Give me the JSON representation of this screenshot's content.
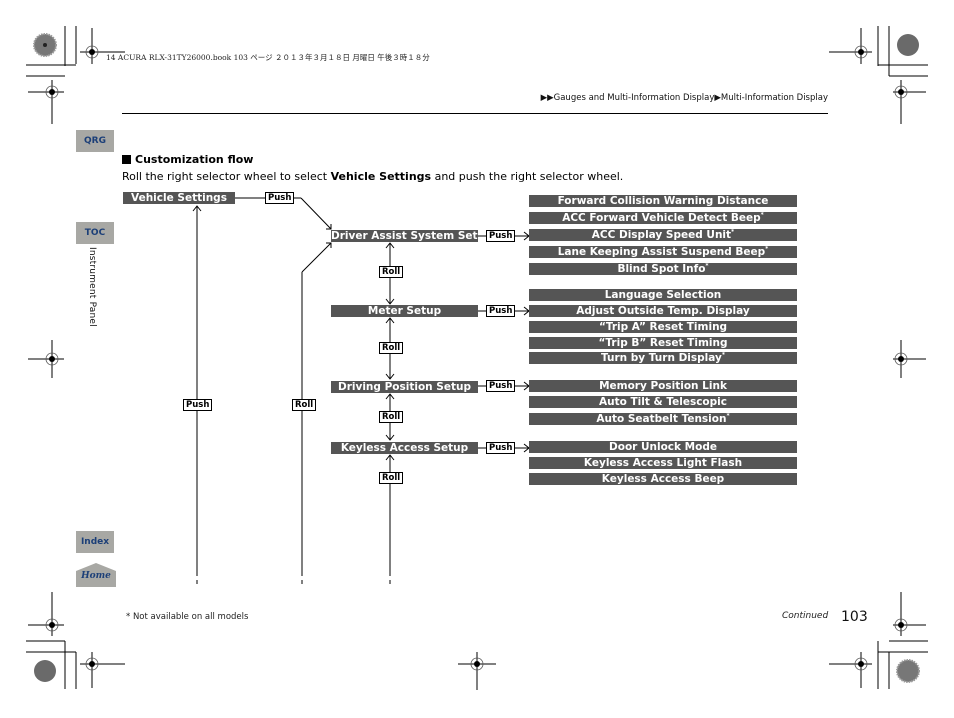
{
  "print_header": "14 ACURA RLX-31TY26000.book  103 ページ  ２０１３年３月１８日  月曜日  午後３時１８分",
  "breadcrumb": {
    "arrow": "▶▶",
    "parts": [
      "Gauges and Multi-Information Display",
      "Multi-Information Display"
    ],
    "separator": "▶"
  },
  "side_nav": {
    "qrg": "QRG",
    "toc": "TOC",
    "section_label": "Instrument Panel",
    "index": "Index",
    "home": "Home"
  },
  "section": {
    "title": "Customization flow",
    "instruction_pre": "Roll the right selector wheel to select ",
    "instruction_bold": "Vehicle Settings",
    "instruction_post": " and push the right selector wheel."
  },
  "flow": {
    "root": "Vehicle Settings",
    "push_label": "Push",
    "roll_label": "Roll",
    "groups": [
      {
        "name": "Driver Assist System Setup",
        "items": [
          {
            "label": "Forward Collision Warning Distance",
            "star": false
          },
          {
            "label": "ACC Forward Vehicle Detect Beep",
            "star": true
          },
          {
            "label": "ACC Display Speed Unit",
            "star": true
          },
          {
            "label": "Lane Keeping Assist Suspend Beep",
            "star": true
          },
          {
            "label": "Blind Spot Info",
            "star": true
          }
        ]
      },
      {
        "name": "Meter Setup",
        "items": [
          {
            "label": "Language Selection",
            "star": false
          },
          {
            "label": "Adjust Outside Temp. Display",
            "star": false
          },
          {
            "label": "“Trip A” Reset Timing",
            "star": false
          },
          {
            "label": "“Trip B” Reset Timing",
            "star": false
          },
          {
            "label": "Turn by Turn Display",
            "star": true
          }
        ]
      },
      {
        "name": "Driving Position Setup",
        "items": [
          {
            "label": "Memory Position Link",
            "star": false
          },
          {
            "label": "Auto Tilt & Telescopic",
            "star": false
          },
          {
            "label": "Auto Seatbelt Tension",
            "star": true
          }
        ]
      },
      {
        "name": "Keyless Access Setup",
        "items": [
          {
            "label": "Door Unlock Mode",
            "star": false
          },
          {
            "label": "Keyless Access Light Flash",
            "star": false
          },
          {
            "label": "Keyless Access Beep",
            "star": false
          }
        ]
      }
    ]
  },
  "footnote": "* Not available on all models",
  "continued": "Continued",
  "page_number": "103",
  "star_symbol": "*"
}
